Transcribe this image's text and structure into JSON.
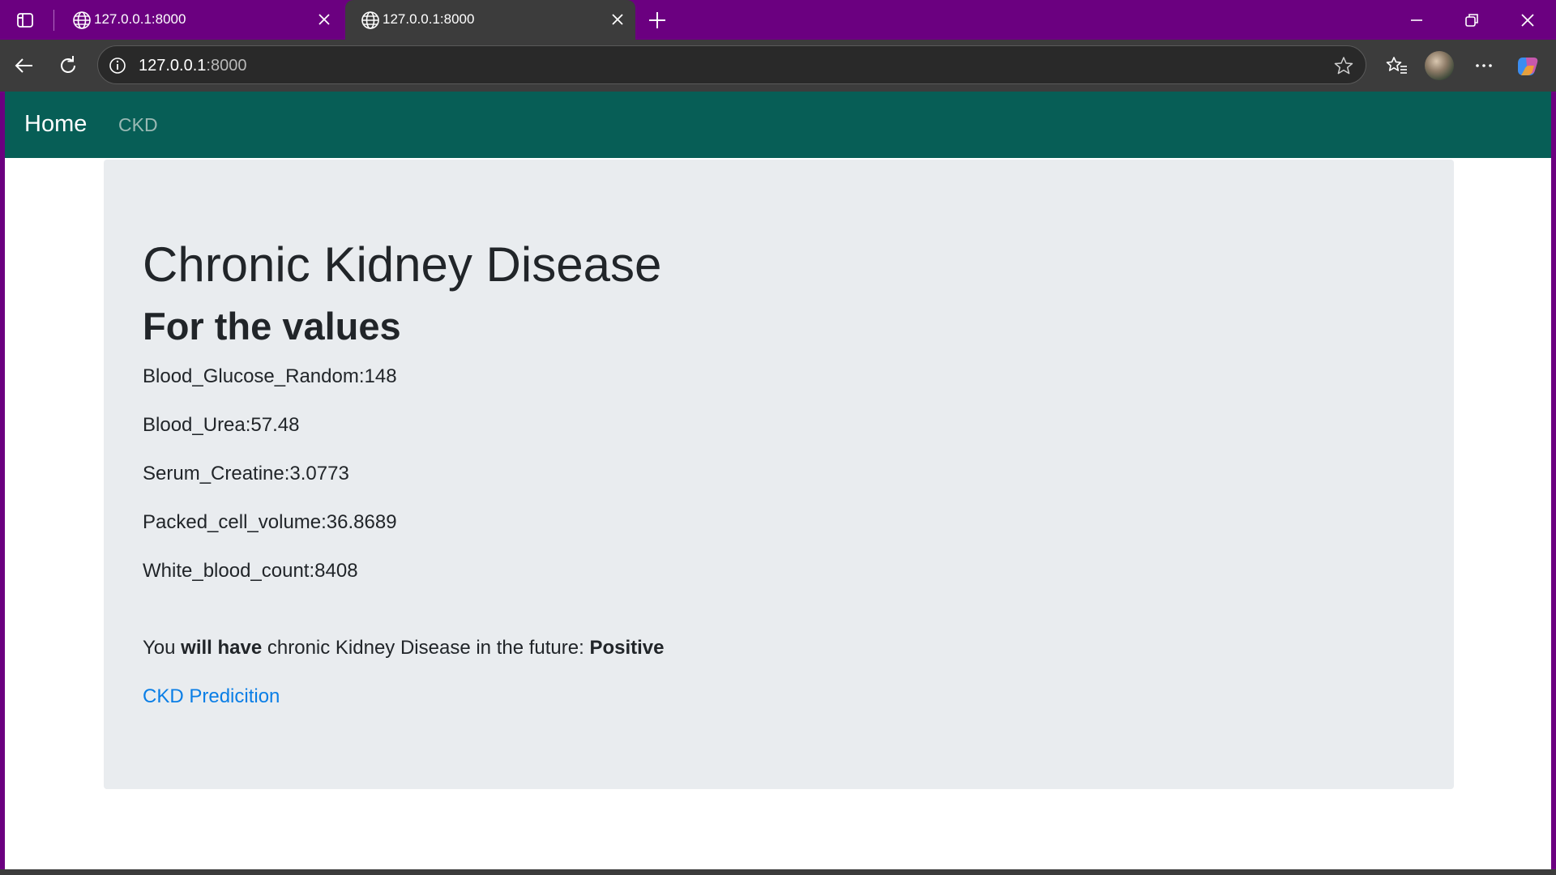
{
  "browser": {
    "tabs": [
      {
        "title": "127.0.0.1:8000",
        "active": false
      },
      {
        "title": "127.0.0.1:8000",
        "active": true
      }
    ],
    "address": {
      "host": "127.0.0.1",
      "port": ":8000"
    }
  },
  "navbar": {
    "brand": "Home",
    "links": [
      {
        "label": "CKD"
      }
    ]
  },
  "main": {
    "title": "Chronic Kidney Disease",
    "subtitle": "For the values",
    "values": [
      "Blood_Glucose_Random:148",
      "Blood_Urea:57.48",
      "Serum_Creatine:3.0773",
      "Packed_cell_volume:36.8689",
      "White_blood_count:8408"
    ],
    "result": {
      "prefix": "You ",
      "emphasis": "will have",
      "middle": " chronic Kidney Disease in the future: ",
      "outcome": "Positive"
    },
    "link_label": "CKD Predicition"
  },
  "colors": {
    "browser_frame": "#6b0080",
    "navbar": "#075e56",
    "jumbotron": "#e9ecef",
    "link": "#0a7ee6"
  }
}
